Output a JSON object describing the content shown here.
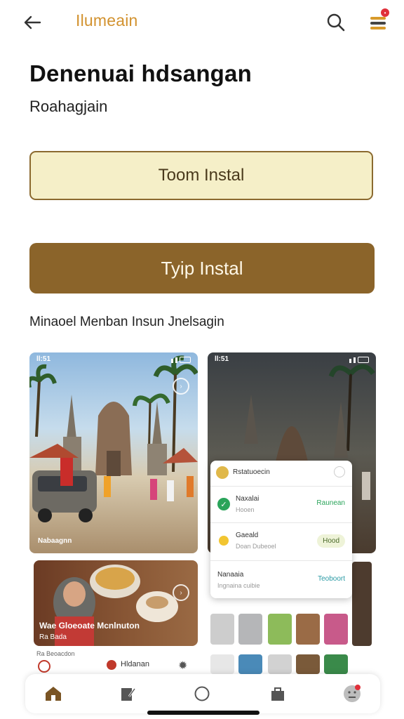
{
  "header": {
    "brand": "Ilumeain",
    "icons": [
      "back-arrow-icon",
      "search-icon",
      "menu-icon"
    ]
  },
  "title": "Denenuai hdsangan",
  "subtitle": "Roahagjain",
  "buttons": {
    "primary_light": "Toom Instal",
    "primary_dark": "Tyip Instal"
  },
  "section_caption": "Minaoel Menban Insun Jnelsagin",
  "cards": {
    "temple": {
      "status_time": "ll:51",
      "caption": "Nabaagnn"
    },
    "phone2": {
      "status_time": "ll:51"
    },
    "food": {
      "caption_line1": "Wae Gloeoate Mcnlnuton",
      "caption_line2": "Ra Bada"
    }
  },
  "popup": {
    "header": "Rstatuoecin",
    "items": [
      {
        "title": "Naxalai",
        "subtitle": "Hooen",
        "action": "Raunean"
      },
      {
        "title": "Gaeald",
        "subtitle": "Doan Dubeoel",
        "action": "Hood"
      },
      {
        "title": "Nanaaia",
        "subtitle": "Ingnaina cuibie",
        "action": "Teoboort"
      }
    ]
  },
  "bottom_strip": {
    "left_label": "Ra Beoacdon",
    "item_label": "Hldanan"
  },
  "bottom_nav": {
    "items": [
      "home-icon",
      "edit-icon",
      "circle-icon",
      "bag-icon",
      "profile-icon"
    ]
  },
  "colors": {
    "brand": "#d2922f",
    "accent_brown": "#8b642a",
    "light_button": "#f5efc8",
    "success_green": "#2aa45a"
  }
}
